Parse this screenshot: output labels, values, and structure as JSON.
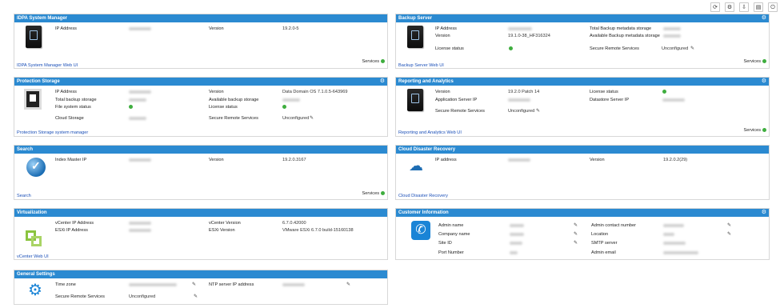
{
  "toolbar": {
    "buttons": [
      {
        "name": "refresh-icon",
        "glyph": "⟳"
      },
      {
        "name": "settings-icon",
        "glyph": "⚙"
      },
      {
        "name": "export-icon",
        "glyph": "⇩"
      },
      {
        "name": "document-icon",
        "glyph": "▤"
      },
      {
        "name": "power-icon",
        "glyph": "⏻"
      }
    ]
  },
  "sm": {
    "title": "IDPA System Manager",
    "ip_label": "IP Address",
    "version_label": "Version",
    "version_value": "19.2.0-5",
    "link": "IDPA System Manager Web UI",
    "services": "Services"
  },
  "bs": {
    "title": "Backup Server",
    "ip_label": "IP Address",
    "version_label": "Version",
    "version_value": "19.1.0-38_HF316324",
    "license_label": "License status",
    "total_meta_label": "Total Backup metadata storage",
    "avail_meta_label": "Available Backup metadata storage",
    "srs_label": "Secure Remote Services",
    "srs_value": "Unconfigured",
    "link": "Backup Server Web UI",
    "services": "Services"
  },
  "ps": {
    "title": "Protection Storage",
    "ip_label": "IP Address",
    "total_label": "Total backup storage",
    "fs_label": "File system status",
    "cloud_label": "Cloud Storage",
    "version_label": "Version",
    "version_value": "Data Domain OS 7.1.0.5-643969",
    "avail_label": "Available backup storage",
    "license_label": "License status",
    "srs_label": "Secure Remote Services",
    "srs_value": "Unconfigured",
    "link": "Protection Storage system manager"
  },
  "ra": {
    "title": "Reporting and Analytics",
    "version_label": "Version",
    "version_value": "19.2.0 Patch 14",
    "app_ip_label": "Application Server IP",
    "srs_label": "Secure Remote Services",
    "srs_value": "Unconfigured",
    "license_label": "License status",
    "ds_ip_label": "Datastore Server IP",
    "link": "Reporting and Analytics Web UI",
    "services": "Services"
  },
  "se": {
    "title": "Search",
    "ip_label": "Index Master IP",
    "version_label": "Version",
    "version_value": "19.2.0.3167",
    "link": "Search",
    "services": "Services"
  },
  "cdr": {
    "title": "Cloud Disaster Recovery",
    "ip_label": "IP address",
    "version_label": "Version",
    "version_value": "19.2.0.2(29)",
    "link": "Cloud Disaster Recovery"
  },
  "vz": {
    "title": "Virtualization",
    "vc_ip_label": "vCenter IP Address",
    "esxi_ip_label": "ESXi IP Address",
    "vc_ver_label": "vCenter Version",
    "vc_ver_value": "6.7.0.42000",
    "esxi_ver_label": "ESXi Version",
    "esxi_ver_value": "VMware ESXi 6.7.0 build-15160138",
    "link": "vCenter Web UI"
  },
  "ci": {
    "title": "Customer Information",
    "admin_name_label": "Admin name",
    "company_label": "Company name",
    "site_label": "Site ID",
    "port_label": "Port Number",
    "admin_contact_label": "Admin contact number",
    "location_label": "Location",
    "smtp_label": "SMTP server",
    "admin_email_label": "Admin email"
  },
  "gs": {
    "title": "General Settings",
    "tz_label": "Time zone",
    "srs_label": "Secure Remote Services",
    "srs_value": "Unconfigured",
    "ntp_label": "NTP server IP address"
  }
}
